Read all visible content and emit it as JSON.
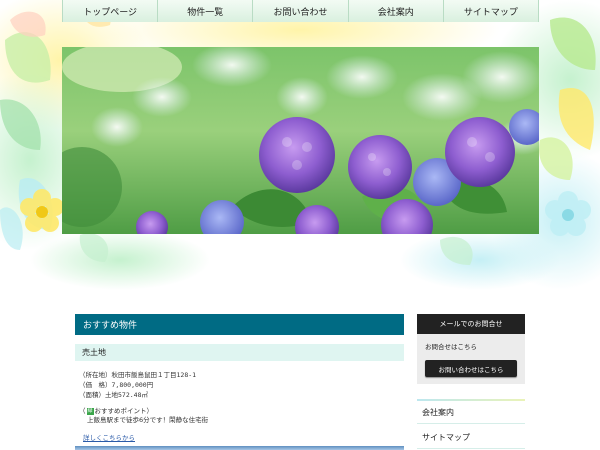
{
  "nav": {
    "items": [
      {
        "label": "トップページ"
      },
      {
        "label": "物件一覧"
      },
      {
        "label": "お問い合わせ"
      },
      {
        "label": "会社案内"
      },
      {
        "label": "サイトマップ"
      }
    ]
  },
  "main": {
    "section_title": "おすすめ物件",
    "category": "売土地",
    "details": {
      "location": "（所在地）秋田市飯島鼠田１丁目128-1",
      "price": "（価　格）7,800,000円",
      "area": "（面積）土地572.48㎡"
    },
    "point_open": "（",
    "point_icon": "緑",
    "point_label": "おすすめポイント）",
    "point_text": "上飯島駅まで徒歩6分です！閑静な住宅街",
    "more_link": "詳しくこちらから"
  },
  "sidebar": {
    "mail_title": "メールでのお問合せ",
    "mail_text": "お問合せはこちら",
    "contact_button": "お問い合わせはこちら",
    "links": [
      {
        "label": "会社案内"
      },
      {
        "label": "サイトマップ"
      }
    ]
  },
  "colors": {
    "section_head": "#006b84",
    "sub_head": "#dff5f1",
    "side_head": "#222222",
    "nav_bg": "#d9f0df"
  }
}
